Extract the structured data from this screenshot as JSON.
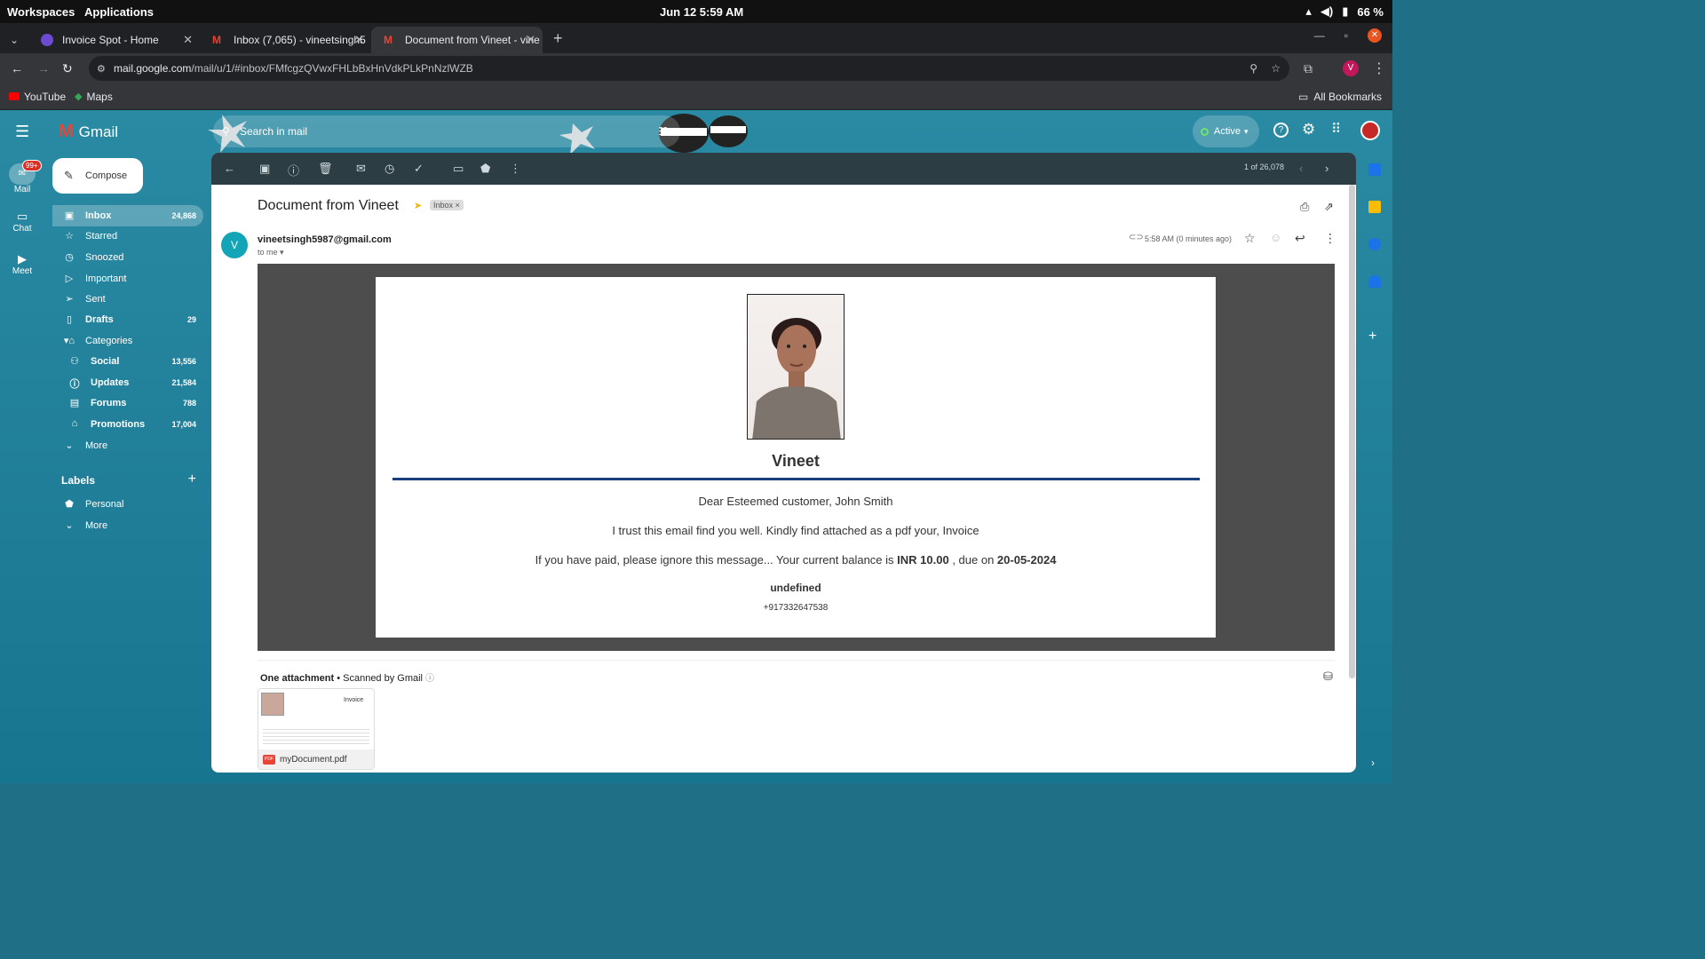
{
  "os": {
    "workspaces": "Workspaces",
    "applications": "Applications",
    "clock": "Jun 12  5:59 AM",
    "battery": "66 %"
  },
  "browser": {
    "tabs": [
      {
        "title": "Invoice Spot - Home"
      },
      {
        "title": "Inbox (7,065) - vineetsingh5"
      },
      {
        "title": "Document from Vineet - vine"
      }
    ],
    "url_host": "mail.google.com",
    "url_path": "/mail/u/1/#inbox/FMfcgzQVwxFHLbBxHnVdkPLkPnNzlWZB",
    "bookmarks": [
      "YouTube",
      "Maps"
    ],
    "all_bookmarks": "All Bookmarks",
    "profile_letter": "V"
  },
  "gmail": {
    "logo": "Gmail",
    "search_placeholder": "Search in mail",
    "status": "Active",
    "rail": {
      "mail": "Mail",
      "mail_badge": "99+",
      "chat": "Chat",
      "meet": "Meet"
    },
    "compose": "Compose",
    "nav": [
      {
        "label": "Inbox",
        "count": "24,868"
      },
      {
        "label": "Starred",
        "count": ""
      },
      {
        "label": "Snoozed",
        "count": ""
      },
      {
        "label": "Important",
        "count": ""
      },
      {
        "label": "Sent",
        "count": ""
      },
      {
        "label": "Drafts",
        "count": "29"
      },
      {
        "label": "Categories",
        "count": ""
      },
      {
        "label": "Social",
        "count": "13,556"
      },
      {
        "label": "Updates",
        "count": "21,584"
      },
      {
        "label": "Forums",
        "count": "788"
      },
      {
        "label": "Promotions",
        "count": "17,004"
      },
      {
        "label": "More",
        "count": ""
      }
    ],
    "labels_title": "Labels",
    "labels": [
      {
        "label": "Personal"
      },
      {
        "label": "More"
      }
    ],
    "pager": "1 of 26,078"
  },
  "email": {
    "subject": "Document from Vineet",
    "tag": "Inbox",
    "avatar_letter": "V",
    "sender": "vineetsingh5987@gmail.com",
    "to": "to me",
    "time": "5:58 AM (0 minutes ago)",
    "body": {
      "name": "Vineet",
      "greeting": "Dear Esteemed customer, John Smith",
      "line1": "I trust this email find you well. Kindly find attached as a pdf your, Invoice",
      "line2_prefix": "If you have paid, please ignore this message... Your current balance is ",
      "balance": "INR 10.00",
      "line2_mid": " , due on ",
      "due": "20-05-2024",
      "undefined": "undefined",
      "phone": "+917332647538"
    },
    "attachment_header": "One attachment",
    "scanned": "Scanned by Gmail",
    "attachment": {
      "filename": "myDocument.pdf",
      "preview_title": "Invoice",
      "pdf_badge": "PDF"
    }
  }
}
